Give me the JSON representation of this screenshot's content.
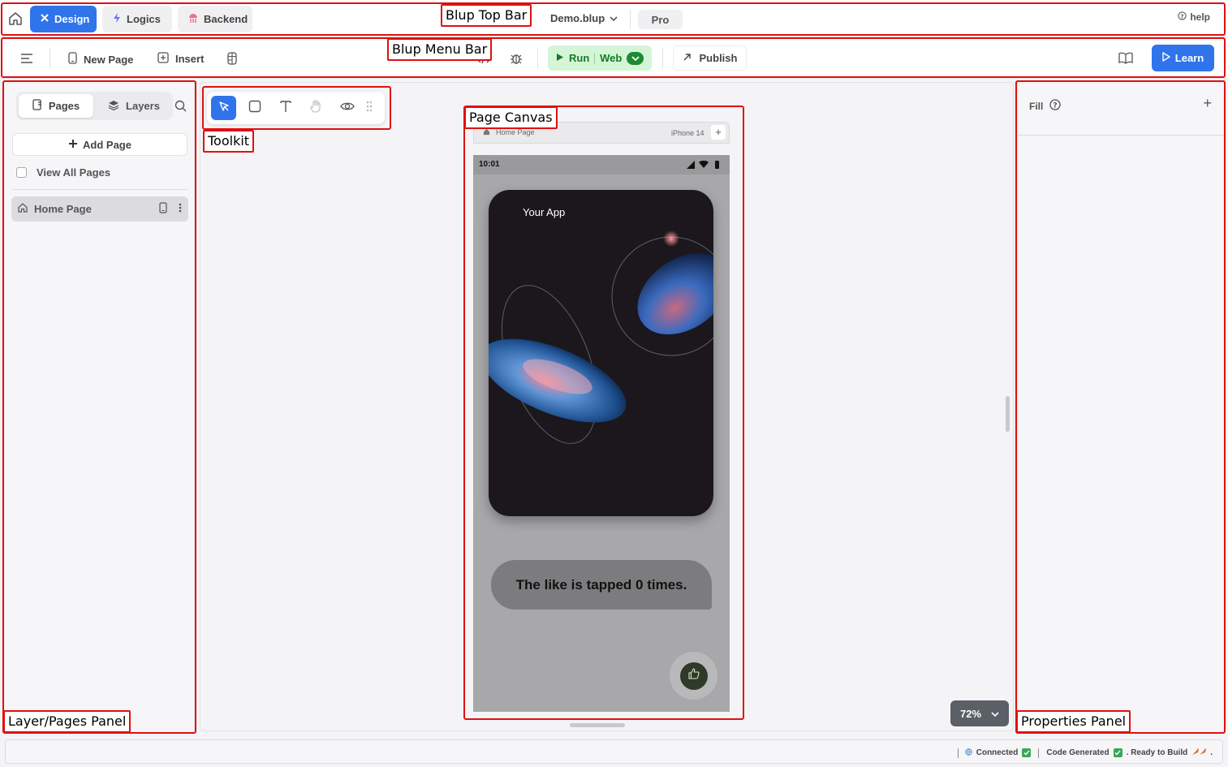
{
  "topbar": {
    "tabs": [
      {
        "label": "Design",
        "icon": "design-icon"
      },
      {
        "label": "Logics",
        "icon": "lightning-icon"
      },
      {
        "label": "Backend",
        "icon": "jellyfish-icon"
      }
    ],
    "project_name": "Demo.blup",
    "plan": "Pro",
    "help": "help"
  },
  "menubar": {
    "new_page": "New Page",
    "insert": "Insert",
    "run": "Run",
    "run_target": "Web",
    "publish": "Publish",
    "learn": "Learn"
  },
  "left_panel": {
    "tab_pages": "Pages",
    "tab_layers": "Layers",
    "add_page": "Add Page",
    "view_all_pages": "View All Pages",
    "pages": [
      {
        "label": "Home Page"
      }
    ]
  },
  "canvas": {
    "page_label": "Home Page",
    "device": "iPhone 14",
    "device_add": "+",
    "time": "10:01",
    "app_title": "Your App",
    "like_text": "The like is tapped 0 times.",
    "zoom": "72%"
  },
  "right_panel": {
    "fill_label": "Fill",
    "add": "+"
  },
  "footer": {
    "connected": "Connected",
    "code_generated": "Code Generated",
    "ready": ". Ready to Build",
    "end": "."
  },
  "annotations": {
    "top_bar": "Blup Top Bar",
    "menu_bar": "Blup Menu Bar",
    "toolkit": "Toolkit",
    "page_canvas": "Page Canvas",
    "layers_panel": "Layer/Pages Panel",
    "properties_panel": "Properties Panel"
  },
  "colors": {
    "accent": "#2f74eb",
    "run_bg": "#d4f5d6",
    "annotation": "#e01010"
  }
}
